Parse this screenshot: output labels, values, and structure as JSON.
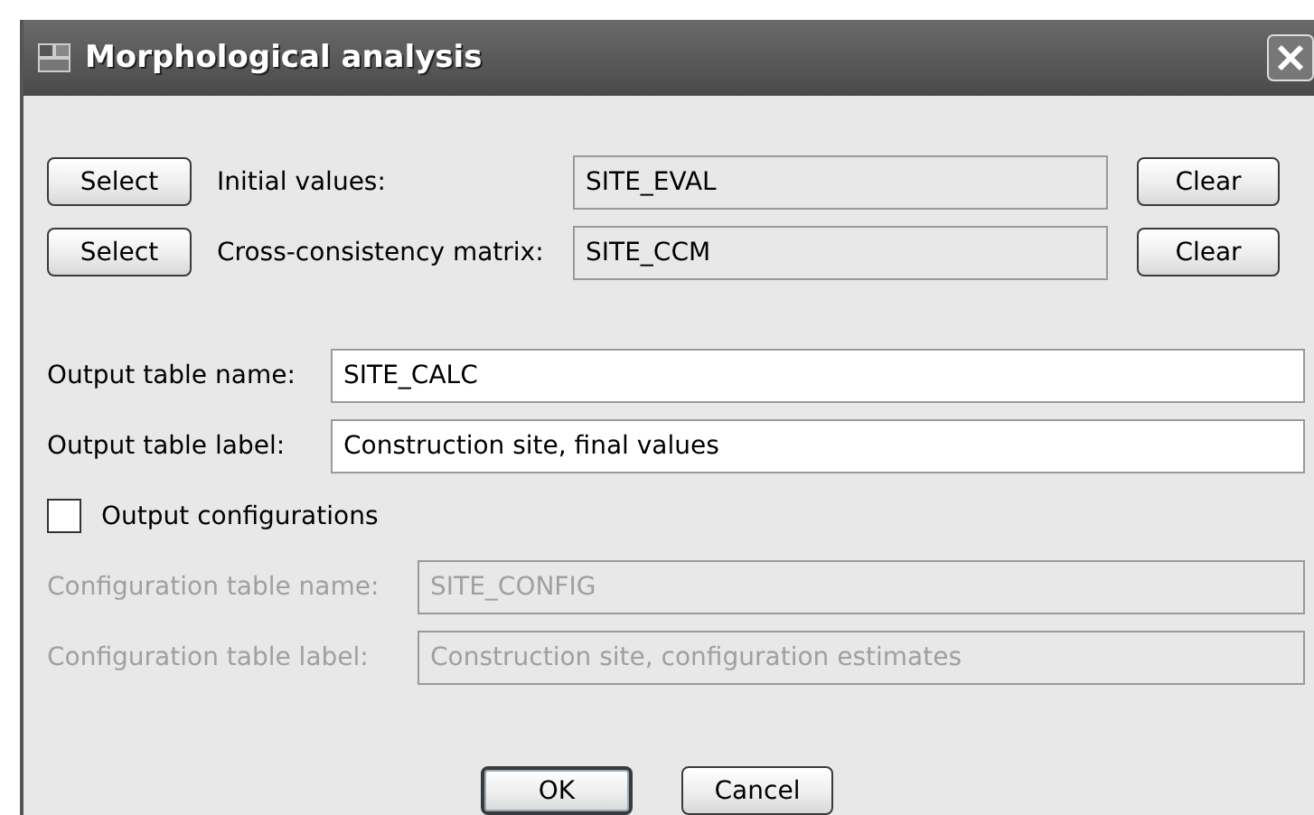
{
  "window": {
    "title": "Morphological analysis"
  },
  "inputs": [
    {
      "button": "Select",
      "label": "Initial values:",
      "value": "SITE_EVAL",
      "clear": "Clear"
    },
    {
      "button": "Select",
      "label": "Cross-consistency matrix:",
      "value": "SITE_CCM",
      "clear": "Clear"
    }
  ],
  "output": [
    {
      "label": "Output table name:",
      "value": "SITE_CALC"
    },
    {
      "label": "Output table label:",
      "value": "Construction site, final values"
    }
  ],
  "output_configurations": {
    "label": "Output configurations",
    "checked": false
  },
  "configuration": [
    {
      "label": "Configuration table name:",
      "value": "SITE_CONFIG",
      "disabled": true
    },
    {
      "label": "Configuration table label:",
      "value": "Construction site, configuration estimates",
      "disabled": true
    }
  ],
  "buttons": [
    {
      "label": "OK",
      "default": true
    },
    {
      "label": "Cancel",
      "default": false
    }
  ]
}
